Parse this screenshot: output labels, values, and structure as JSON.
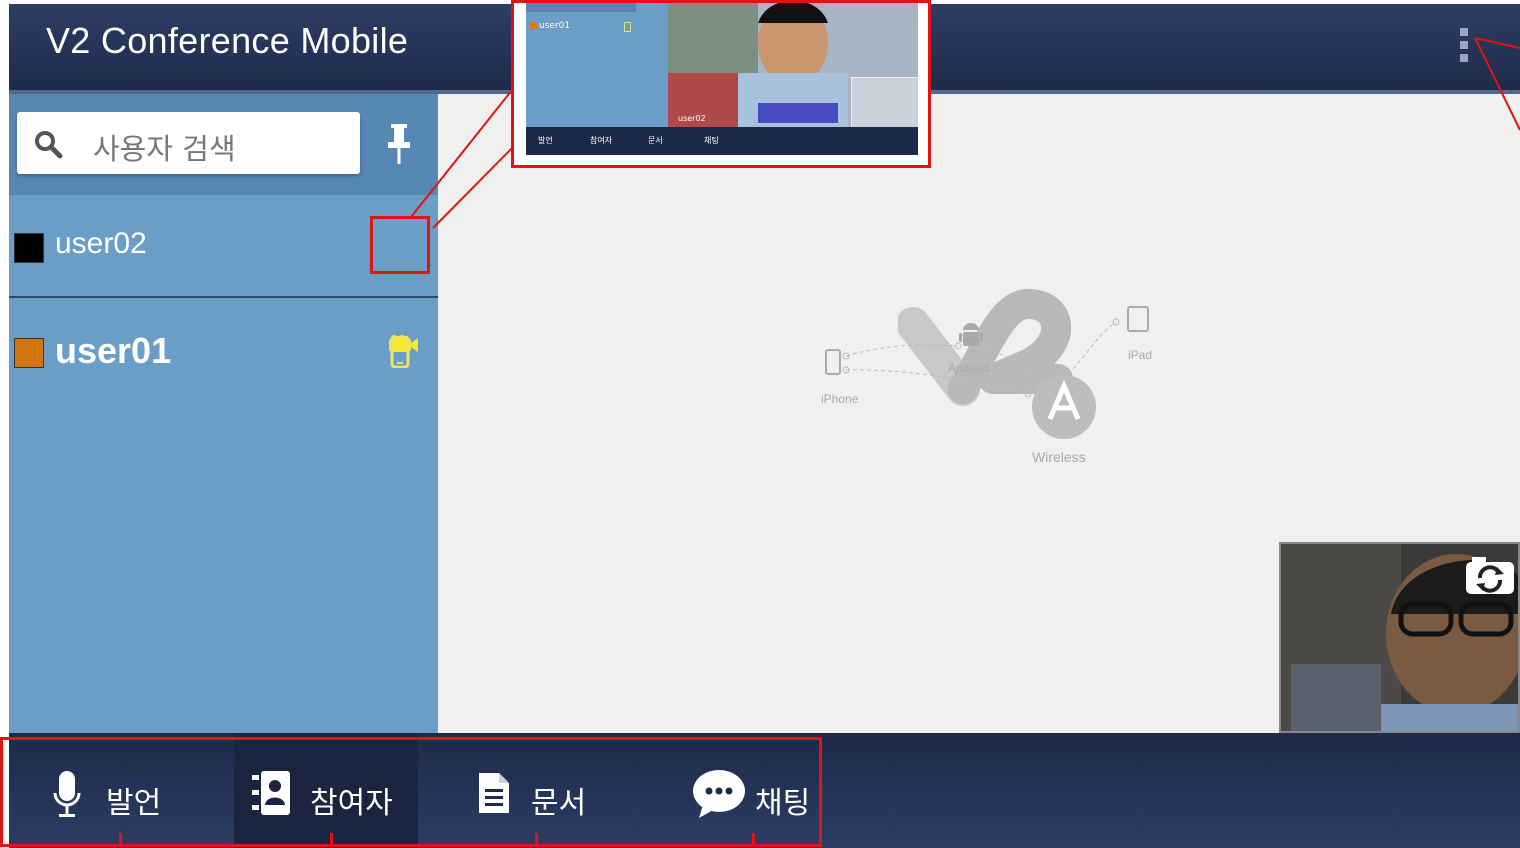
{
  "header": {
    "title": "V2 Conference Mobile",
    "menu_icon": "overflow-menu-icon"
  },
  "sidebar": {
    "search_placeholder": "사용자 검색",
    "users": [
      {
        "name": "user02",
        "color": "#000000",
        "device": "video-camera-icon",
        "device_color": "#f5e92b"
      },
      {
        "name": "user01",
        "color": "#d2760c",
        "device": "phone-icon",
        "device_color": "#e9e36a"
      }
    ]
  },
  "canvas": {
    "diagram_labels": {
      "android": "Android",
      "iphone": "iPhone",
      "ipad": "iPad",
      "wireless": "Wireless"
    }
  },
  "bottom_bar": {
    "tabs": [
      {
        "label": "발언",
        "icon": "microphone-icon",
        "active": false
      },
      {
        "label": "참여자",
        "icon": "contacts-icon",
        "active": true
      },
      {
        "label": "문서",
        "icon": "document-icon",
        "active": false
      },
      {
        "label": "채팅",
        "icon": "chat-bubble-icon",
        "active": false
      }
    ]
  },
  "inset": {
    "user": "user01",
    "video_caption": "user02",
    "tabs": [
      "발언",
      "참여자",
      "문서",
      "채팅"
    ]
  },
  "colors": {
    "highlight": "#e01414",
    "header": "#25345a",
    "sidebar": "#6b9ec6"
  }
}
